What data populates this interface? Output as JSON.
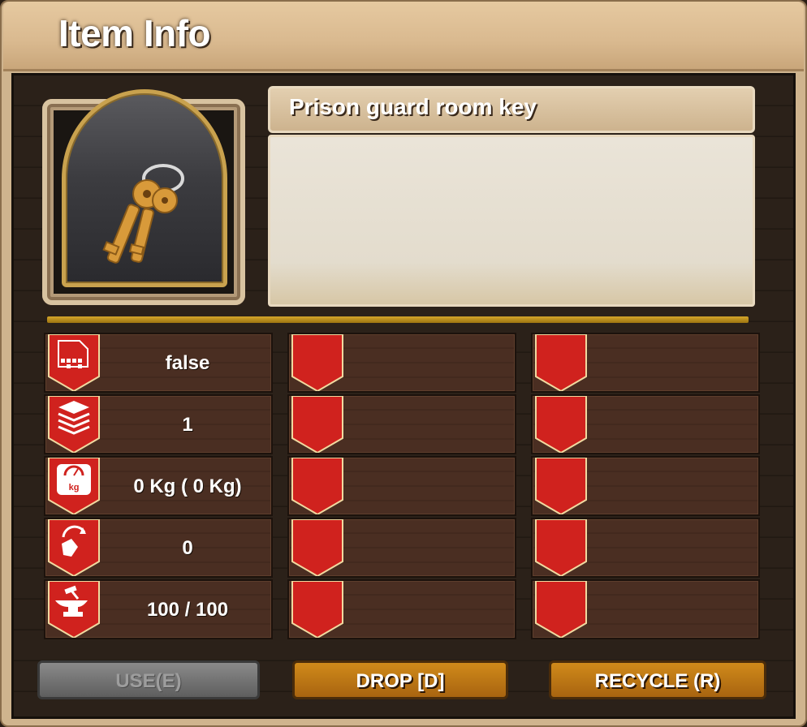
{
  "window": {
    "title": "Item Info"
  },
  "item": {
    "name": "Prison guard room key",
    "description": "",
    "icon": "keys-icon"
  },
  "stats": [
    {
      "icon": "memory-blocks-icon",
      "value": "false"
    },
    {
      "icon": "stack-layers-icon",
      "value": "1"
    },
    {
      "icon": "weight-scale-icon",
      "value": "0 Kg ( 0 Kg)"
    },
    {
      "icon": "arrow-hand-icon",
      "value": "0"
    },
    {
      "icon": "anvil-icon",
      "value": "100 / 100"
    }
  ],
  "buttons": {
    "use": "USE(E)",
    "drop": "DROP [D]",
    "recycle": "RECYCLE (R)"
  },
  "colors": {
    "badge_red": "#d0221e",
    "gold_accent": "#c9a24e",
    "button_orange": "#c07a16",
    "button_disabled": "#6e6e6e"
  }
}
